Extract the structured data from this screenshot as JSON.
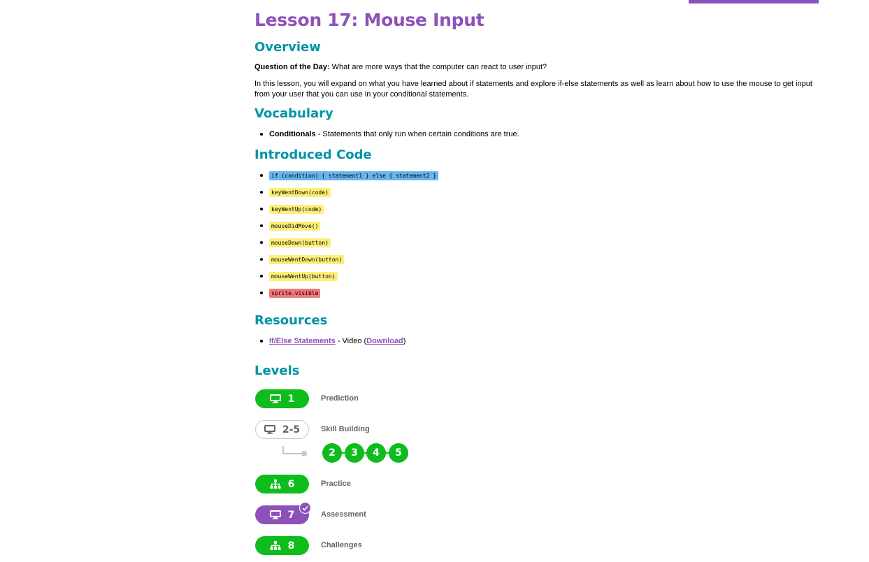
{
  "lesson_title": "Lesson 17: Mouse Input",
  "overview": {
    "heading": "Overview",
    "qotd_label": "Question of the Day:",
    "qotd_text": " What are more ways that the computer can react to user input?",
    "paragraph": "In this lesson, you will expand on what you have learned about if statements and explore if-else statements as well as learn about how to use the mouse to get input from your user that you can use in your conditional statements."
  },
  "vocabulary": {
    "heading": "Vocabulary",
    "items": [
      {
        "term": "Conditionals",
        "definition": " - Statements that only run when certain conditions are true."
      }
    ]
  },
  "introduced_code": {
    "heading": "Introduced Code",
    "items": [
      {
        "code": "if (condition) { statement1 } else { statement2 }",
        "color": "#68b5ee"
      },
      {
        "code": "keyWentDown(code)",
        "color": "#fdef78"
      },
      {
        "code": "keyWentUp(code)",
        "color": "#fdef78"
      },
      {
        "code": "mouseDidMove()",
        "color": "#fdef78"
      },
      {
        "code": "mouseDown(button)",
        "color": "#fdef78"
      },
      {
        "code": "mouseWentDown(button)",
        "color": "#fdef78"
      },
      {
        "code": "mouseWentUp(button)",
        "color": "#fdef78"
      },
      {
        "code": "sprite.visible",
        "color": "#f27878"
      }
    ]
  },
  "resources": {
    "heading": "Resources",
    "item_link": "If/Else Statements",
    "item_type": " - Video (",
    "download_link": "Download",
    "item_close": ")"
  },
  "levels": {
    "heading": "Levels",
    "rows": [
      {
        "number": "1",
        "label": "Prediction",
        "icon": "computer-icon",
        "style": "green"
      },
      {
        "number": "2-5",
        "label": "Skill Building",
        "icon": "computer-icon",
        "style": "outline"
      },
      {
        "number": "6",
        "label": "Practice",
        "icon": "sitemap-icon",
        "style": "green"
      },
      {
        "number": "7",
        "label": "Assessment",
        "icon": "computer-icon",
        "style": "purple",
        "completed": true
      },
      {
        "number": "8",
        "label": "Challenges",
        "icon": "sitemap-icon",
        "style": "green"
      }
    ],
    "sublevels": [
      "2",
      "3",
      "4",
      "5"
    ]
  },
  "colors": {
    "title_purple": "#8c52ba",
    "heading_teal": "#0094a7",
    "level_green": "#0ebd1c"
  }
}
